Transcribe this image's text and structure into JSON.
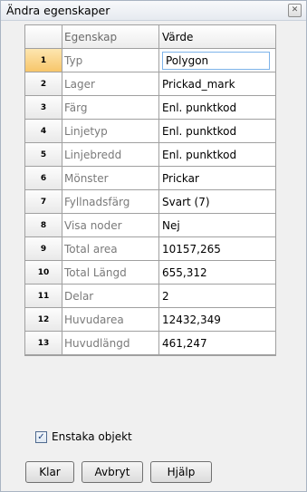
{
  "window": {
    "title": "Ändra egenskaper",
    "close_glyph": "✕"
  },
  "grid": {
    "header": {
      "num": "",
      "property": "Egenskap",
      "value": "Värde"
    },
    "rows": [
      {
        "num": "1",
        "property": "Typ",
        "value": "Polygon"
      },
      {
        "num": "2",
        "property": "Lager",
        "value": "Prickad_mark"
      },
      {
        "num": "3",
        "property": "Färg",
        "value": "Enl. punktkod"
      },
      {
        "num": "4",
        "property": "Linjetyp",
        "value": "Enl. punktkod"
      },
      {
        "num": "5",
        "property": "Linjebredd",
        "value": "Enl. punktkod"
      },
      {
        "num": "6",
        "property": "Mönster",
        "value": "Prickar"
      },
      {
        "num": "7",
        "property": "Fyllnadsfärg",
        "value": "Svart (7)"
      },
      {
        "num": "8",
        "property": "Visa noder",
        "value": "Nej"
      },
      {
        "num": "9",
        "property": "Total area",
        "value": "10157,265"
      },
      {
        "num": "10",
        "property": "Total Längd",
        "value": "655,312"
      },
      {
        "num": "11",
        "property": "Delar",
        "value": "2"
      },
      {
        "num": "12",
        "property": "Huvudarea",
        "value": "12432,349"
      },
      {
        "num": "13",
        "property": "Huvudlängd",
        "value": "461,247"
      }
    ],
    "selected_row": "1"
  },
  "options": {
    "single_objects_label": "Enstaka objekt",
    "single_objects_checked": true,
    "check_glyph": "✓"
  },
  "buttons": {
    "ok": "Klar",
    "cancel": "Avbryt",
    "help": "Hjälp"
  }
}
